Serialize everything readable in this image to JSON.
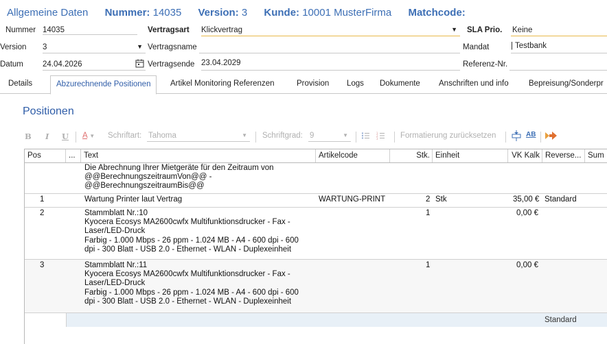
{
  "header": {
    "title": "Allgemeine Daten",
    "nummer_label": "Nummer:",
    "nummer_value": "14035",
    "version_label": "Version:",
    "version_value": "3",
    "kunde_label": "Kunde:",
    "kunde_value": "10001 MusterFirma",
    "matchcode_label": "Matchcode:"
  },
  "form": {
    "nummer_label": "Nummer",
    "nummer_value": "14035",
    "version_label": "Version",
    "version_value": "3",
    "datum_label": "Datum",
    "datum_value": "24.04.2026",
    "vertragsart_label": "Vertragsart",
    "vertragsart_value": "Klickvertrag",
    "vertragsname_label": "Vertragsname",
    "vertragsname_value": "",
    "vertragsende_label": "Vertragsende",
    "vertragsende_value": "23.04.2029",
    "sla_label": "SLA Prio.",
    "sla_value": "Keine",
    "mandat_label": "Mandat",
    "mandat_value": "| Testbank",
    "referenz_label": "Referenz-Nr.",
    "referenz_value": ""
  },
  "tabs": [
    {
      "label": "Details"
    },
    {
      "label": "Abzurechnende Positionen"
    },
    {
      "label": "Artikel Monitoring Referenzen"
    },
    {
      "label": "Provision"
    },
    {
      "label": "Logs"
    },
    {
      "label": "Dokumente"
    },
    {
      "label": "Anschriften und info"
    },
    {
      "label": "Bepreisung/Sonderpr"
    }
  ],
  "section": {
    "title": "Positionen"
  },
  "toolbar": {
    "bold": "B",
    "italic": "I",
    "underline": "U",
    "font_label": "Schriftart:",
    "font_value": "Tahoma",
    "size_label": "Schriftgrad:",
    "size_value": "9",
    "reset_label": "Formatierung zurücksetzen"
  },
  "grid": {
    "headers": [
      "Pos",
      "...",
      "Text",
      "Artikelcode",
      "Stk.",
      "Einheit",
      "VK Kalk",
      "Reverse...",
      "Sum"
    ],
    "rows": [
      {
        "pos": "",
        "text": [
          "Die Abrechnung Ihrer Mietgeräte für den Zeitraum von",
          "@@BerechnungszeitraumVon@@ -",
          "@@BerechnungszeitraumBis@@"
        ],
        "artikelcode": "",
        "stk": "",
        "einheit": "",
        "vk": "",
        "reverse": ""
      },
      {
        "pos": "1",
        "text": [
          "Wartung Printer laut Vertrag"
        ],
        "artikelcode": "WARTUNG-PRINT",
        "stk": "2",
        "einheit": "Stk",
        "vk": "35,00 €",
        "reverse": "Standard"
      },
      {
        "pos": "2",
        "text": [
          "Stammblatt Nr.:10",
          "Kyocera Ecosys MA2600cwfx Multifunktionsdrucker - Fax -",
          "Laser/LED-Druck",
          "Farbig - 1.000 Mbps - 26 ppm - 1.024 MB - A4 - 600 dpi - 600",
          "dpi - 300 Blatt - USB 2.0 - Ethernet - WLAN - Duplexeinheit"
        ],
        "artikelcode": "",
        "stk": "1",
        "einheit": "",
        "vk": "0,00 €",
        "reverse": ""
      },
      {
        "pos": "3",
        "text": [
          "Stammblatt Nr.:11",
          "Kyocera Ecosys MA2600cwfx Multifunktionsdrucker - Fax -",
          "Laser/LED-Druck",
          "Farbig - 1.000 Mbps - 26 ppm - 1.024 MB - A4 - 600 dpi - 600",
          "dpi - 300 Blatt - USB 2.0 - Ethernet - WLAN - Duplexeinheit"
        ],
        "artikelcode": "",
        "stk": "1",
        "einheit": "",
        "vk": "0,00 €",
        "reverse": ""
      }
    ],
    "footer_reverse": "Standard"
  },
  "colors": {
    "accent": "#2f5da8",
    "title": "#3d6fb5",
    "sla_underline": "#e8b84a",
    "footer": "#e8f0f7"
  }
}
